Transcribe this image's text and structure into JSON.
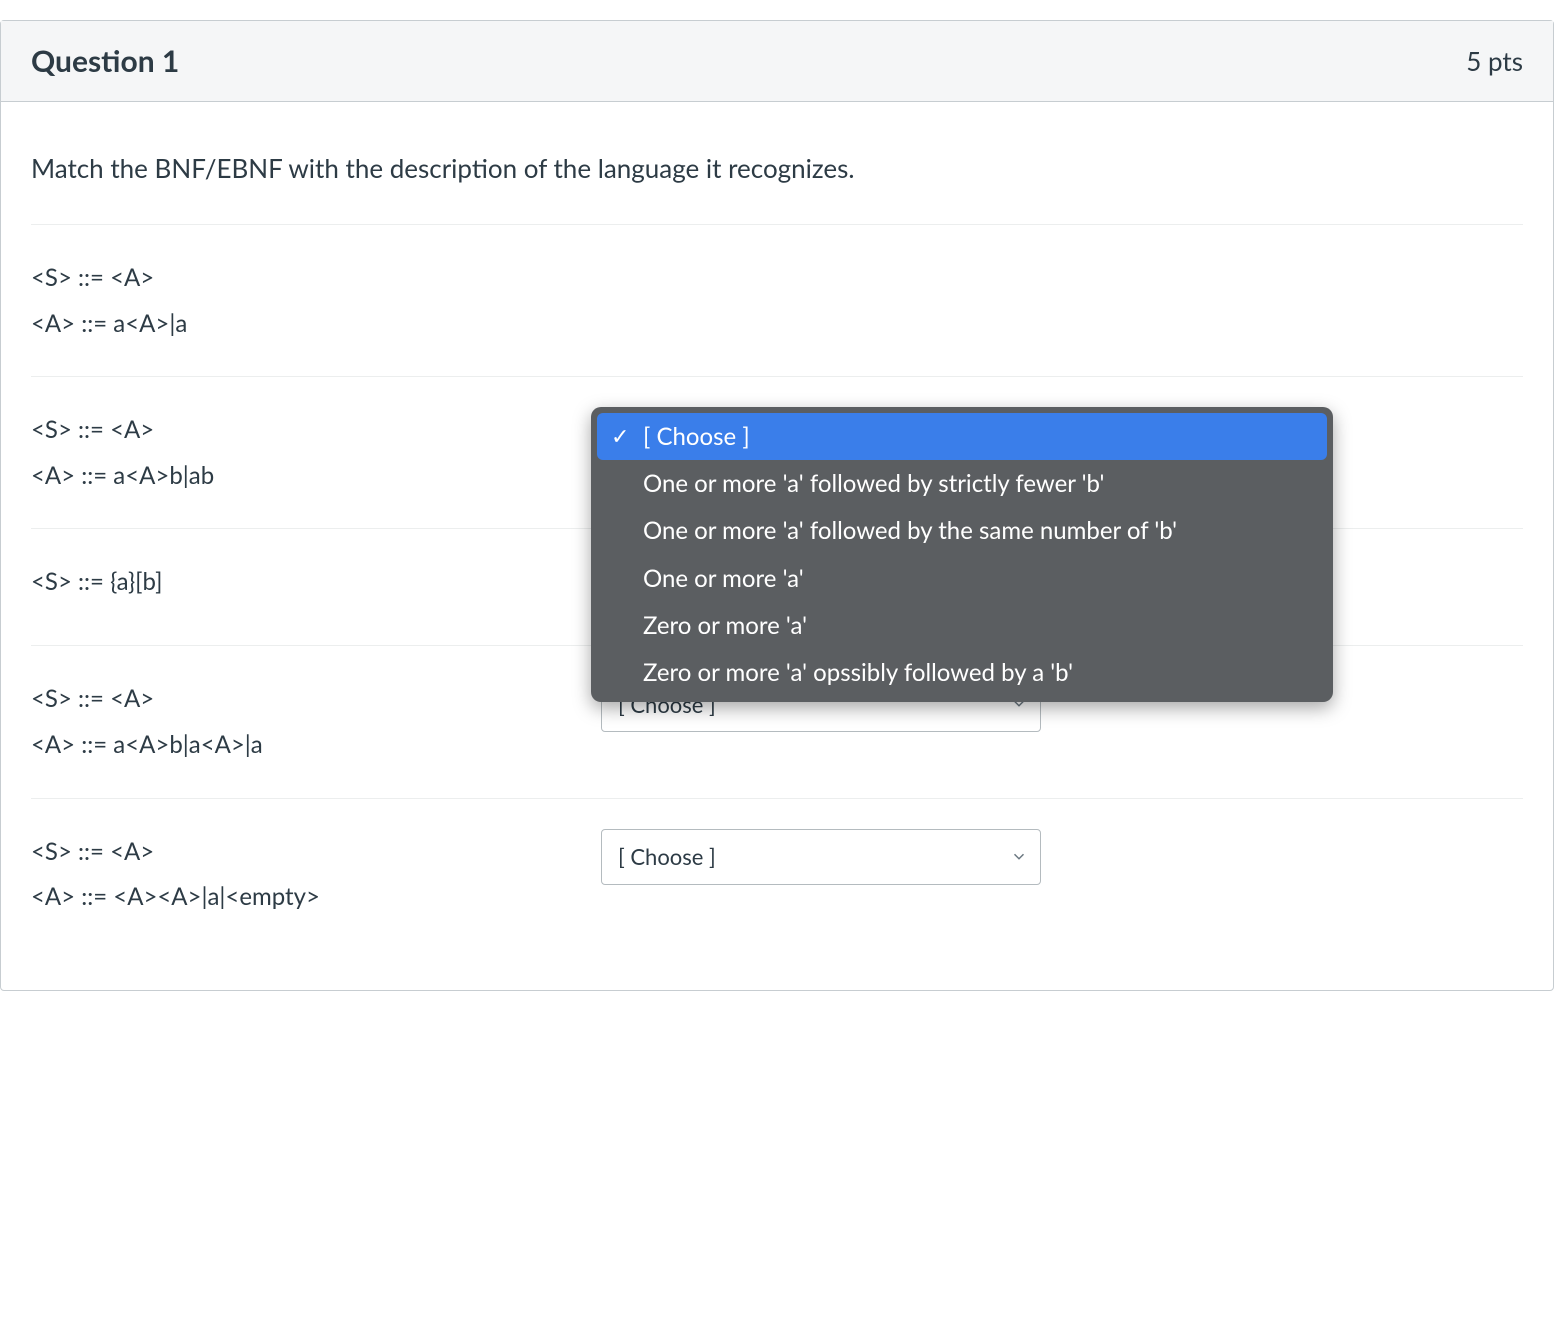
{
  "header": {
    "title": "Question 1",
    "points": "5 pts"
  },
  "prompt": "Match the BNF/EBNF with the description of the language it recognizes.",
  "choose_placeholder": "[ Choose ]",
  "rows": [
    {
      "lines": [
        "<S> ::= <A>",
        "<A> ::= a<A>|a"
      ]
    },
    {
      "lines": [
        "<S> ::= <A>",
        "<A> ::= a<A>b|ab"
      ]
    },
    {
      "lines": [
        "<S> ::= {a}[b]"
      ]
    },
    {
      "lines": [
        "<S> ::= <A>",
        "<A> ::= a<A>b|a<A>|a"
      ]
    },
    {
      "lines": [
        "<S> ::= <A>",
        "<A> ::= <A><A>|a|<empty>"
      ]
    }
  ],
  "menu": {
    "options": [
      "[ Choose ]",
      "One or more 'a' followed by strictly fewer 'b'",
      "One or more 'a' followed by the same number of 'b'",
      "One or more 'a'",
      "Zero or more 'a'",
      "Zero or more 'a' opssibly followed by a 'b'"
    ],
    "selected_index": 0
  }
}
